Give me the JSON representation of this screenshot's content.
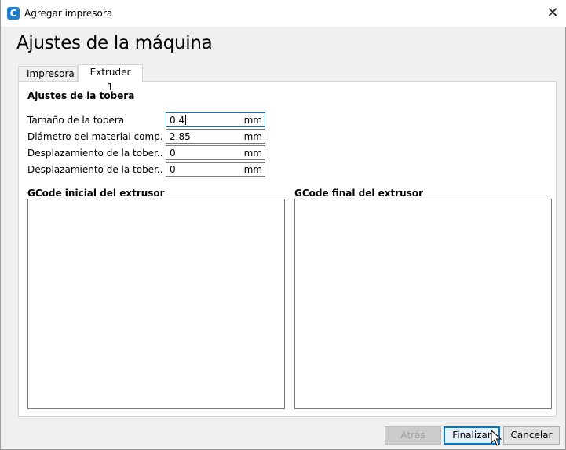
{
  "window": {
    "title": "Agregar impresora",
    "app_icon_letter": "C",
    "close_glyph": "✕"
  },
  "page_title": "Ajustes de la máquina",
  "tabs": [
    {
      "label": "Impresora",
      "active": false
    },
    {
      "label": "Extruder 1",
      "active": true
    }
  ],
  "nozzle_section": {
    "title": "Ajustes de la tobera",
    "rows": [
      {
        "label": "Tamaño de la tobera",
        "value": "0.4",
        "unit": "mm",
        "focused": true
      },
      {
        "label": "Diámetro del material comp...",
        "value": "2.85",
        "unit": "mm",
        "focused": false
      },
      {
        "label": "Desplazamiento de la tober...",
        "value": "0",
        "unit": "mm",
        "focused": false
      },
      {
        "label": "Desplazamiento de la tober...",
        "value": "0",
        "unit": "mm",
        "focused": false
      }
    ]
  },
  "gcode": {
    "start_label": "GCode inicial del extrusor",
    "start_value": "",
    "end_label": "GCode final del extrusor",
    "end_value": ""
  },
  "buttons": {
    "back": "Atrás",
    "finish": "Finalizar",
    "cancel": "Cancelar"
  },
  "colors": {
    "accent": "#0078d7",
    "app_icon": "#1c7fd6"
  }
}
